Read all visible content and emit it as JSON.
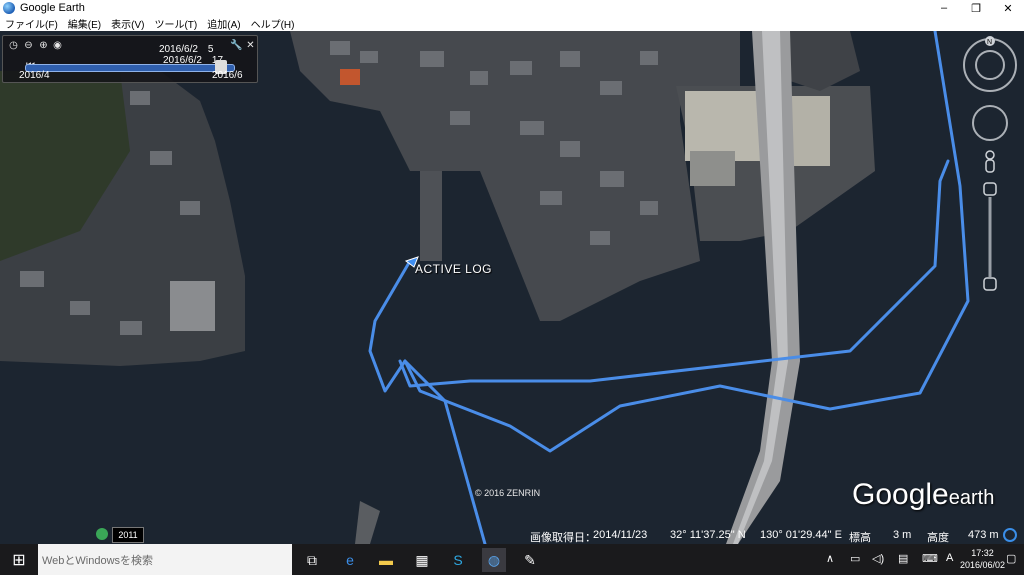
{
  "window": {
    "title": "Google Earth",
    "min_icon": "–",
    "max_icon": "❐",
    "close_icon": "✕"
  },
  "menu": {
    "items": [
      "ファイル(F)",
      "編集(E)",
      "表示(V)",
      "ツール(T)",
      "追加(A)",
      "ヘルプ(H)"
    ]
  },
  "time_slider": {
    "current_start": "2016/6/2　5",
    "current_end": "2016/6/2　17",
    "range_start": "2016/4",
    "range_end": "2016/6"
  },
  "map": {
    "placemark_label": "ACTIVE LOG",
    "copyright": "© 2016 ZENRIN",
    "logo_main": "Google",
    "logo_sub": "earth",
    "imagery_year": "2011"
  },
  "status": {
    "imagery_date_label": "画像取得日：",
    "imagery_date": "2014/11/23",
    "lat": "32° 11'37.25\" N",
    "lon": "130° 01'29.44\" E",
    "elev_label": "標高",
    "elev_value": "3 m",
    "eye_alt_label": "高度",
    "eye_alt_value": "473 m"
  },
  "taskbar": {
    "search_placeholder": "WebとWindowsを検索",
    "ime": "A",
    "clock_time": "17:32",
    "clock_date": "2016/06/02"
  },
  "colors": {
    "track": "#4a8de8",
    "water": "#1b2430",
    "land": "#3e4349"
  }
}
